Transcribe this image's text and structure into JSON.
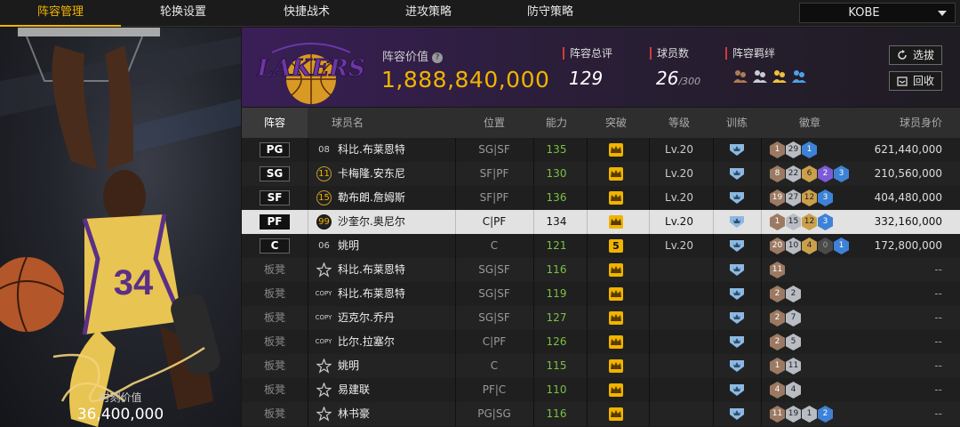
{
  "nav": {
    "tabs": [
      "阵容管理",
      "轮换设置",
      "快捷战术",
      "进攻策略",
      "防守策略"
    ],
    "active_index": 0,
    "user": "KOBE"
  },
  "card": {
    "jersey_number": "34",
    "market_value_label": "时刻价值",
    "market_value": "36,400,000"
  },
  "header": {
    "team_value_label": "阵容价值",
    "team_value": "1,888,840,000",
    "rating_label": "阵容总评",
    "rating": "129",
    "players_label": "球员数",
    "players_count": "26",
    "players_max": "/300",
    "bond_label": "阵容羁绊",
    "select_button": "选拔",
    "recycle_button": "回收",
    "accent_color": "#f0b400"
  },
  "table": {
    "headers": [
      "阵容",
      "球员名",
      "位置",
      "能力",
      "突破",
      "等级",
      "训练",
      "徽章",
      "球员身价"
    ],
    "rows": [
      {
        "slot": "PG",
        "num": "08",
        "num_style": "plain",
        "name": "科比.布莱恩特",
        "position": "SG|SF",
        "ability": "135",
        "breakthrough": "crown",
        "level": "Lv.20",
        "badges": [
          {
            "c": "b",
            "t": "1"
          },
          {
            "c": "s",
            "t": "29"
          },
          {
            "c": "bl",
            "t": "1"
          }
        ],
        "value": "621,440,000"
      },
      {
        "slot": "SG",
        "num": "11",
        "num_style": "hex",
        "name": "卡梅隆.安东尼",
        "position": "SF|PF",
        "ability": "130",
        "breakthrough": "crown",
        "level": "Lv.20",
        "badges": [
          {
            "c": "b",
            "t": "8"
          },
          {
            "c": "s",
            "t": "22"
          },
          {
            "c": "g",
            "t": "6"
          },
          {
            "c": "p",
            "t": "2"
          },
          {
            "c": "bl",
            "t": "3"
          }
        ],
        "value": "210,560,000"
      },
      {
        "slot": "SF",
        "num": "15",
        "num_style": "hex",
        "name": "勒布朗.詹姆斯",
        "position": "SF|PF",
        "ability": "136",
        "breakthrough": "crown",
        "level": "Lv.20",
        "badges": [
          {
            "c": "b",
            "t": "19"
          },
          {
            "c": "s",
            "t": "27"
          },
          {
            "c": "g",
            "t": "12"
          },
          {
            "c": "bl",
            "t": "3"
          }
        ],
        "value": "404,480,000"
      },
      {
        "slot": "PF",
        "num": "99",
        "num_style": "hexsel",
        "name": "沙奎尔.奥尼尔",
        "position": "C|PF",
        "ability": "134",
        "breakthrough": "crown",
        "level": "Lv.20",
        "badges": [
          {
            "c": "b",
            "t": "1"
          },
          {
            "c": "s",
            "t": "15"
          },
          {
            "c": "g",
            "t": "12"
          },
          {
            "c": "bl",
            "t": "3"
          }
        ],
        "value": "332,160,000",
        "selected": true
      },
      {
        "slot": "C",
        "num": "06",
        "num_style": "plain",
        "name": "姚明",
        "position": "C",
        "ability": "121",
        "breakthrough": "5",
        "level": "Lv.20",
        "badges": [
          {
            "c": "b",
            "t": "20"
          },
          {
            "c": "s",
            "t": "10"
          },
          {
            "c": "g",
            "t": "4"
          },
          {
            "c": "d",
            "t": "0"
          },
          {
            "c": "bl",
            "t": "1"
          }
        ],
        "value": "172,800,000"
      },
      {
        "slot": "板凳",
        "num": "star",
        "num_style": "plain",
        "name": "科比.布莱恩特",
        "position": "SG|SF",
        "ability": "116",
        "breakthrough": "crown",
        "level": "",
        "badges": [
          {
            "c": "b",
            "t": "11"
          }
        ],
        "value": "--"
      },
      {
        "slot": "板凳",
        "num": "COPY",
        "num_style": "plain",
        "name": "科比.布莱恩特",
        "position": "SG|SF",
        "ability": "119",
        "breakthrough": "crown",
        "level": "",
        "badges": [
          {
            "c": "b",
            "t": "2"
          },
          {
            "c": "s",
            "t": "2"
          }
        ],
        "value": "--"
      },
      {
        "slot": "板凳",
        "num": "COPY",
        "num_style": "plain",
        "name": "迈克尔.乔丹",
        "position": "SG|SF",
        "ability": "127",
        "breakthrough": "crown",
        "level": "",
        "badges": [
          {
            "c": "b",
            "t": "2"
          },
          {
            "c": "s",
            "t": "7"
          }
        ],
        "value": "--"
      },
      {
        "slot": "板凳",
        "num": "COPY",
        "num_style": "plain",
        "name": "比尔.拉塞尔",
        "position": "C|PF",
        "ability": "126",
        "breakthrough": "crown",
        "level": "",
        "badges": [
          {
            "c": "b",
            "t": "2"
          },
          {
            "c": "s",
            "t": "5"
          }
        ],
        "value": "--"
      },
      {
        "slot": "板凳",
        "num": "star",
        "num_style": "plain",
        "name": "姚明",
        "position": "C",
        "ability": "115",
        "breakthrough": "crown",
        "level": "",
        "badges": [
          {
            "c": "b",
            "t": "1"
          },
          {
            "c": "s",
            "t": "11"
          }
        ],
        "value": "--"
      },
      {
        "slot": "板凳",
        "num": "star",
        "num_style": "plain",
        "name": "易建联",
        "position": "PF|C",
        "ability": "110",
        "breakthrough": "crown",
        "level": "",
        "badges": [
          {
            "c": "b",
            "t": "4"
          },
          {
            "c": "s",
            "t": "4"
          }
        ],
        "value": "--"
      },
      {
        "slot": "板凳",
        "num": "star",
        "num_style": "plain",
        "name": "林书豪",
        "position": "PG|SG",
        "ability": "116",
        "breakthrough": "crown",
        "level": "",
        "badges": [
          {
            "c": "b",
            "t": "11"
          },
          {
            "c": "s",
            "t": "19"
          },
          {
            "c": "s",
            "t": "1"
          },
          {
            "c": "bl",
            "t": "2"
          }
        ],
        "value": "--"
      }
    ]
  }
}
